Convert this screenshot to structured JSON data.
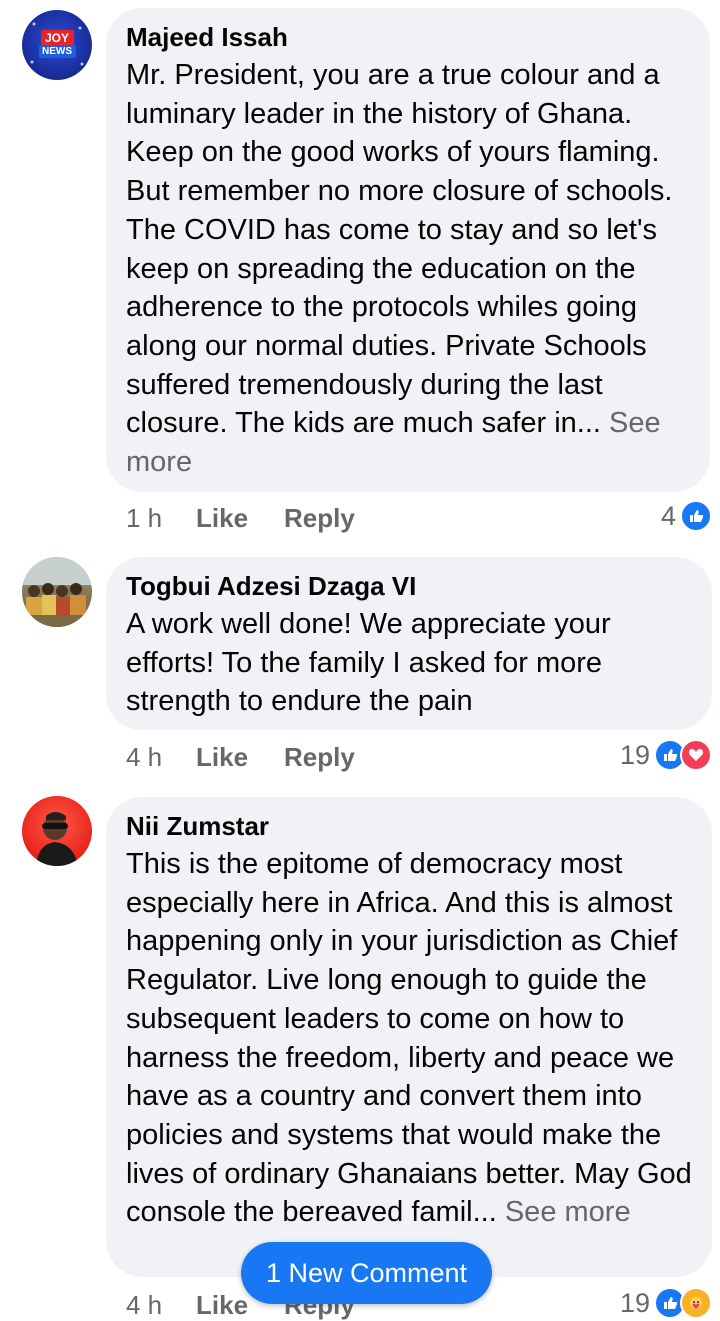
{
  "comments": [
    {
      "author": "Majeed Issah",
      "avatar_text_1": "JOY",
      "avatar_text_2": "NEWS",
      "text": "Mr. President, you are a true colour and a luminary leader in the history of Ghana. Keep on the good works of yours flaming. But remember no more closure of schools. The COVID has come to stay and so let's keep on spreading the education on the adherence to the protocols whiles going along our normal duties. Private Schools suffered tremendously during the last closure. The kids are much safer in...",
      "see_more": "See more",
      "time": "1 h",
      "like": "Like",
      "reply": "Reply",
      "reaction_count": "4"
    },
    {
      "author": "Togbui Adzesi Dzaga VI",
      "text": "A work well done! We appreciate your efforts! To the family I asked for more strength to endure the pain",
      "time": "4 h",
      "like": "Like",
      "reply": "Reply",
      "reaction_count": "19"
    },
    {
      "author": "Nii Zumstar",
      "text": "This is the epitome of democracy most especially here in Africa. And this is almost happening only in your jurisdiction as Chief Regulator. Live long enough to guide the subsequent leaders to come on how to harness the freedom, liberty and peace we have as a country and convert them into policies and systems that would make the lives of ordinary Ghanaians better. May God console the bereaved famil...",
      "see_more": "See more",
      "time": "4 h",
      "like": "Like",
      "reply": "Reply",
      "reaction_count": "19"
    }
  ],
  "new_comment_label": "1 New Comment",
  "colors": {
    "accent": "#1877f2",
    "bubble": "#f0f2f5",
    "meta": "#65676b",
    "love": "#f33e58"
  }
}
